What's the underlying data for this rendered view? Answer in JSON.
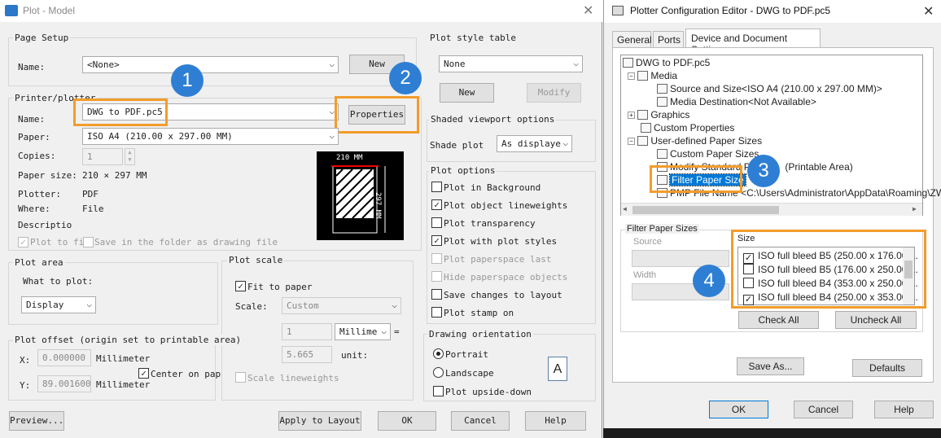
{
  "plot": {
    "title": "Plot - Model",
    "page_setup": {
      "label": "Page Setup",
      "name_label": "Name:",
      "name_value": "<None>",
      "new_btn": "New"
    },
    "plot_style": {
      "label": "Plot style table",
      "value": "None",
      "new_btn": "New",
      "modify_btn": "Modify"
    },
    "printer": {
      "label": "Printer/plotter",
      "name_label": "Name:",
      "name_value": "DWG to PDF.pc5",
      "properties_btn": "Properties",
      "paper_label": "Paper:",
      "paper_value": "ISO A4 (210.00 x 297.00 MM)",
      "copies_label": "Copies:",
      "copies_value": "1",
      "paper_size_label": "Paper size:",
      "paper_size_value": "210 × 297  MM",
      "plotter_label": "Plotter:",
      "plotter_value": "PDF",
      "where_label": "Where:",
      "where_value": "File",
      "description_label": "Descriptio",
      "plot_to_file": "Plot to fi",
      "save_in_folder": "Save in the folder as drawing file",
      "preview_width": "210 MM",
      "preview_height": "297 MM"
    },
    "shaded": {
      "label": "Shaded viewport options",
      "shade_label": "Shade plot",
      "shade_value": "As displaye"
    },
    "plot_options": {
      "label": "Plot options",
      "items": [
        {
          "label": "Plot in Background",
          "checked": false,
          "enabled": true
        },
        {
          "label": "Plot object lineweights",
          "checked": true,
          "enabled": true
        },
        {
          "label": "Plot transparency",
          "checked": false,
          "enabled": true
        },
        {
          "label": "Plot with plot styles",
          "checked": true,
          "enabled": true
        },
        {
          "label": "Plot paperspace last",
          "checked": false,
          "enabled": false
        },
        {
          "label": "Hide paperspace objects",
          "checked": false,
          "enabled": false
        },
        {
          "label": "Save changes to layout",
          "checked": false,
          "enabled": true
        },
        {
          "label": "Plot stamp on",
          "checked": false,
          "enabled": true
        }
      ]
    },
    "plot_area": {
      "label": "Plot area",
      "what_label": "What to plot:",
      "what_value": "Display"
    },
    "plot_scale": {
      "label": "Plot scale",
      "fit": "Fit to paper",
      "scale_label": "Scale:",
      "scale_value": "Custom",
      "num1": "1",
      "unit_value": "Millime",
      "eq": "=",
      "num2": "5.665",
      "unit_label": "unit:",
      "scale_lw": "Scale lineweights"
    },
    "offset": {
      "label": "Plot offset (origin set to printable area)",
      "x_label": "X:",
      "x_value": "0.000000",
      "y_label": "Y:",
      "y_value": "89.001600",
      "unit": "Millimeter",
      "center": "Center on pap"
    },
    "orientation": {
      "label": "Drawing orientation",
      "portrait": "Portrait",
      "landscape": "Landscape",
      "upside": "Plot upside-down",
      "icon_letter": "A"
    },
    "buttons": {
      "preview": "Preview...",
      "apply": "Apply to Layout",
      "ok": "OK",
      "cancel": "Cancel",
      "help": "Help"
    }
  },
  "pce": {
    "title": "Plotter Configuration Editor - DWG to PDF.pc5",
    "tabs": [
      "General",
      "Ports",
      "Device and Document Settings"
    ],
    "tree": [
      "DWG to PDF.pc5",
      "Media",
      "Source and Size<ISO A4 (210.00 x 297.00 MM)>",
      "Media Destination<Not Available>",
      "Graphics",
      "Custom Properties",
      "User-defined Paper Sizes",
      "Custom Paper Sizes",
      "Modify Standard Pa",
      "(Printable Area)",
      "Filter Paper Size",
      "PMP File Name <C:\\Users\\Administrator\\AppData\\Roaming\\ZW"
    ],
    "filter_label": "Filter Paper Sizes",
    "source_label": "Source",
    "width_label": "Width",
    "size_label": "Size",
    "sizes": [
      {
        "label": "ISO full bleed B5 (250.00 x 176.00 ...",
        "checked": true
      },
      {
        "label": "ISO full bleed B5 (176.00 x 250.00 ...",
        "checked": false
      },
      {
        "label": "ISO full bleed B4 (353.00 x 250.00 ...",
        "checked": false
      },
      {
        "label": "ISO full bleed B4 (250.00 x 353.00 ...",
        "checked": true
      }
    ],
    "check_all": "Check All",
    "uncheck_all": "Uncheck All",
    "save_as": "Save As...",
    "defaults": "Defaults",
    "ok": "OK",
    "cancel": "Cancel",
    "help": "Help"
  },
  "badges": [
    "1",
    "2",
    "3",
    "4"
  ],
  "colors": {
    "highlight": "#f39c2b",
    "badge": "#2e7fd4",
    "selection": "#0078d7"
  }
}
